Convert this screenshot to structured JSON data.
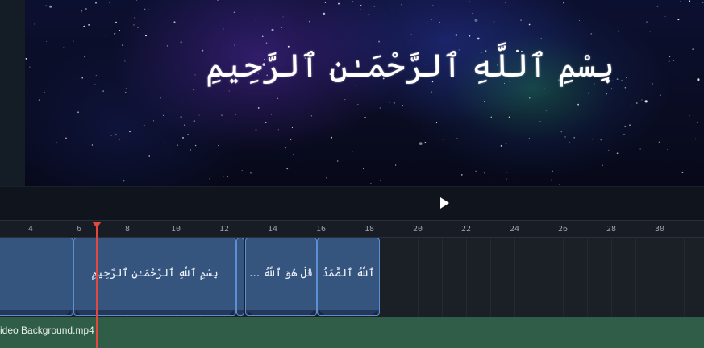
{
  "preview": {
    "verse_text": "بِسْمِ ٱللَّهِ ٱلرَّحْمَـٰنِ ٱلرَّحِيمِ",
    "background": "starfield-nebula"
  },
  "player": {
    "play_icon": "play-icon"
  },
  "ruler": {
    "ticks": [
      "4",
      "6",
      "8",
      "10",
      "12",
      "14",
      "16",
      "18",
      "20",
      "22",
      "24",
      "26",
      "28",
      "30"
    ]
  },
  "timeline": {
    "playhead_time_s": 6.7,
    "clips": [
      {
        "label": ""
      },
      {
        "label": "بِسْمِ ٱللَّهِ ٱلرَّحْمَـٰنِ ٱلرَّحِيمِ"
      },
      {
        "label": ""
      },
      {
        "label": "قُلْ هُوَ ٱللَّهُ …"
      },
      {
        "label": "ٱللَّهُ ٱلصَّمَدُ"
      }
    ],
    "video_track_label": "ideo Background.mp4"
  },
  "colors": {
    "clip_fill": "#35557f",
    "clip_border": "#5b8fd6",
    "video_track": "#2f5d48",
    "playhead": "#e2493e"
  }
}
